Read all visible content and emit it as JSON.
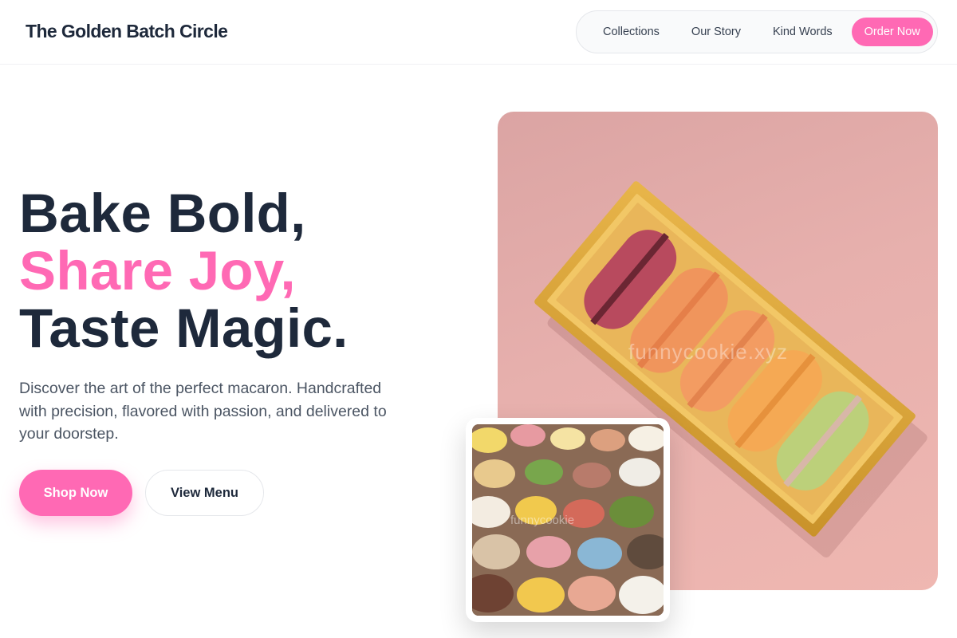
{
  "header": {
    "brand": "The Golden Batch Circle",
    "nav": [
      {
        "label": "Collections"
      },
      {
        "label": "Our Story"
      },
      {
        "label": "Kind Words"
      }
    ],
    "cta": "Order Now"
  },
  "hero": {
    "headline": [
      "Bake Bold,",
      "Share Joy,",
      "Taste Magic."
    ],
    "description": "Discover the art of the perfect macaron. Handcrafted with precision, flavored with passion, and delivered to your doorstep.",
    "primary_button": "Shop Now",
    "secondary_button": "View Menu"
  },
  "images": {
    "main_watermark": "funnycookie.xyz",
    "inset_watermark": "funnycookie"
  },
  "colors": {
    "accent": "#ff69b4",
    "text_dark": "#1e293b",
    "text_muted": "#4b5563"
  }
}
